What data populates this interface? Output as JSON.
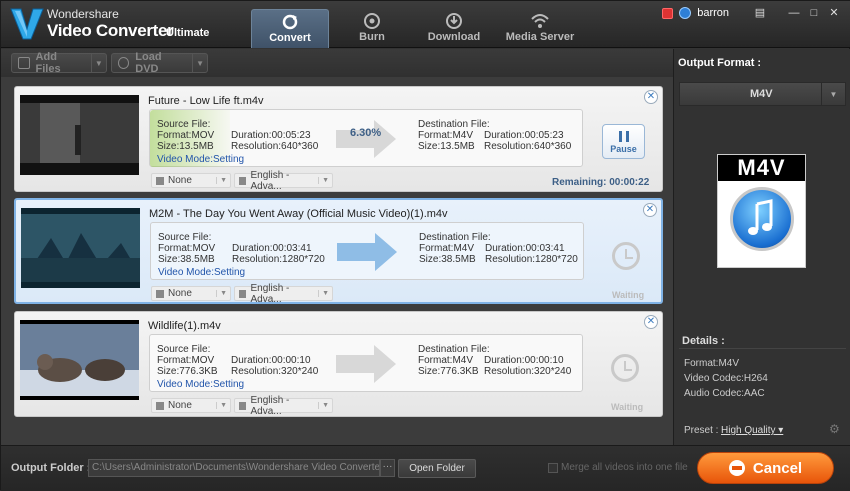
{
  "app": {
    "brand_top": "Wondershare",
    "brand_main": "Video Converter",
    "brand_edition": "Ultimate"
  },
  "tabs": [
    {
      "label": "Convert",
      "icon": "convert-icon",
      "active": true
    },
    {
      "label": "Burn",
      "icon": "burn-icon",
      "active": false
    },
    {
      "label": "Download",
      "icon": "download-icon",
      "active": false
    },
    {
      "label": "Media Server",
      "icon": "wifi-icon",
      "active": false
    }
  ],
  "user": {
    "name": "barron"
  },
  "toolbar": {
    "add_files": "Add Files",
    "load_dvd": "Load DVD"
  },
  "items": [
    {
      "filename": "Future - Low Life ft.m4v",
      "source": {
        "title": "Source File:",
        "format": "Format:MOV",
        "size": "Size:13.5MB",
        "duration": "Duration:00:05:23",
        "resolution": "Resolution:640*360"
      },
      "dest": {
        "title": "Destination File:",
        "format": "Format:M4V",
        "size": "Size:13.5MB",
        "duration": "Duration:00:05:23",
        "resolution": "Resolution:640*360"
      },
      "video_mode": "Video Mode:Setting",
      "progress": "6.30%",
      "subtitle": "None",
      "audio": "English - Adva...",
      "status": "Remaining: 00:00:22",
      "action": "Pause"
    },
    {
      "filename": "M2M - The Day You Went Away (Official Music Video)(1).m4v",
      "source": {
        "title": "Source File:",
        "format": "Format:MOV",
        "size": "Size:38.5MB",
        "duration": "Duration:00:03:41",
        "resolution": "Resolution:1280*720"
      },
      "dest": {
        "title": "Destination File:",
        "format": "Format:M4V",
        "size": "Size:38.5MB",
        "duration": "Duration:00:03:41",
        "resolution": "Resolution:1280*720"
      },
      "video_mode": "Video Mode:Setting",
      "subtitle": "None",
      "audio": "English - Adva...",
      "status": "Waiting"
    },
    {
      "filename": "Wildlife(1).m4v",
      "source": {
        "title": "Source File:",
        "format": "Format:MOV",
        "size": "Size:776.3KB",
        "duration": "Duration:00:00:10",
        "resolution": "Resolution:320*240"
      },
      "dest": {
        "title": "Destination File:",
        "format": "Format:M4V",
        "size": "Size:776.3KB",
        "duration": "Duration:00:00:10",
        "resolution": "Resolution:320*240"
      },
      "video_mode": "Video Mode:Setting",
      "subtitle": "None",
      "audio": "English - Adva...",
      "status": "Waiting"
    }
  ],
  "right_panel": {
    "title": "Output Format :",
    "format": "M4V",
    "badge": "M4V",
    "details_title": "Details :",
    "details": [
      "Format:M4V",
      "Video Codec:H264",
      "Audio Codec:AAC"
    ],
    "preset_label": "Preset :",
    "preset_value": "High Quality"
  },
  "bottom": {
    "output_label": "Output Folder :",
    "output_path": "C:\\Users\\Administrator\\Documents\\Wondershare Video Converter Ultimate",
    "browse": "···",
    "open_folder": "Open Folder",
    "merge_label": "Merge all videos into one file",
    "cancel": "Cancel"
  },
  "colors": {
    "accent": "#3d5f86",
    "cancel": "#f07a20",
    "link": "#2255aa"
  }
}
